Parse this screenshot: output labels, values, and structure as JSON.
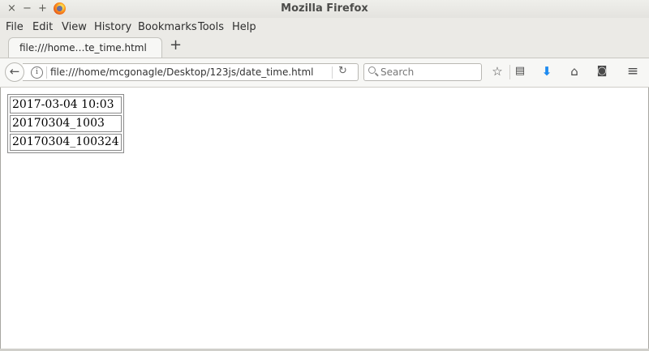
{
  "window": {
    "title": "Mozilla Firefox",
    "controls": [
      "×",
      "−",
      "+"
    ]
  },
  "menu": {
    "items": [
      {
        "label": "File"
      },
      {
        "label": "Edit"
      },
      {
        "label": "View"
      },
      {
        "label": "History"
      },
      {
        "label": "Bookmarks"
      },
      {
        "label": "Tools"
      },
      {
        "label": "Help"
      }
    ]
  },
  "tabs": [
    {
      "label": "file:///home…te_time.html",
      "active": true
    }
  ],
  "toolbar": {
    "url": "file:///home/mcgonagle/Desktop/123js/date_time.html",
    "search_placeholder": "Search",
    "icons": [
      "back-arrow-icon",
      "info-icon",
      "reload-icon",
      "search-icon",
      "bookmark-star-icon",
      "reading-list-icon",
      "downloads-icon",
      "home-icon",
      "pocket-icon",
      "hamburger-menu-icon"
    ]
  },
  "page": {
    "rows": [
      "2017-03-04 10:03",
      "20170304_1003",
      "20170304_100324"
    ]
  }
}
